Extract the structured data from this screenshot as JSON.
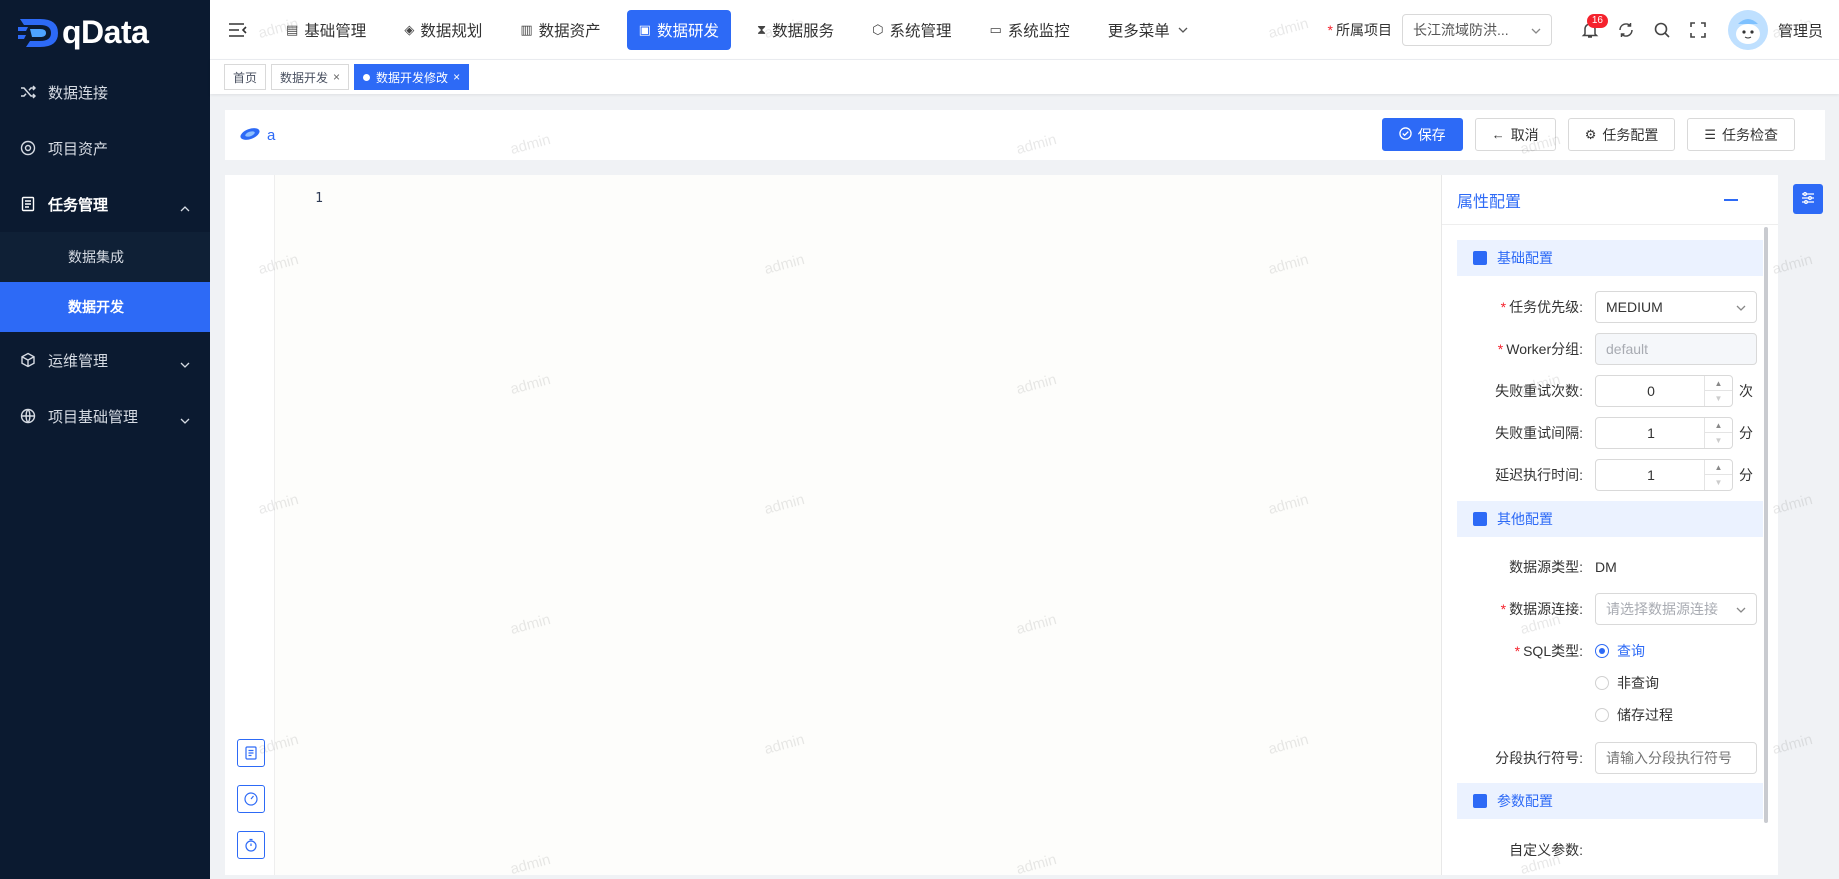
{
  "app": {
    "logo_text": "qData"
  },
  "sidebar": {
    "items": [
      {
        "label": "数据连接"
      },
      {
        "label": "项目资产"
      },
      {
        "label": "任务管理"
      },
      {
        "label": "运维管理"
      },
      {
        "label": "项目基础管理"
      }
    ],
    "task_sub": [
      {
        "label": "数据集成"
      },
      {
        "label": "数据开发"
      }
    ]
  },
  "topnav": {
    "items": [
      {
        "label": "基础管理"
      },
      {
        "label": "数据规划"
      },
      {
        "label": "数据资产"
      },
      {
        "label": "数据研发"
      },
      {
        "label": "数据服务"
      },
      {
        "label": "系统管理"
      },
      {
        "label": "系统监控"
      },
      {
        "label": "更多菜单"
      }
    ],
    "active": "数据研发"
  },
  "header": {
    "project_label": "所属项目",
    "project_value": "长江流域防洪...",
    "notification_count": "16",
    "user_name": "管理员"
  },
  "tabs": [
    {
      "label": "首页"
    },
    {
      "label": "数据开发"
    },
    {
      "label": "数据开发修改"
    }
  ],
  "toolbar": {
    "task_name": "a",
    "save": "保存",
    "cancel": "取消",
    "config": "任务配置",
    "check": "任务检查"
  },
  "editor": {
    "line_number": "1"
  },
  "props": {
    "title": "属性配置",
    "sections": {
      "basic": "基础配置",
      "other": "其他配置",
      "params": "参数配置"
    },
    "priority_label": "任务优先级:",
    "priority_value": "MEDIUM",
    "worker_label": "Worker分组:",
    "worker_value": "default",
    "retry_times_label": "失败重试次数:",
    "retry_times_value": "0",
    "retry_times_unit": "次",
    "retry_interval_label": "失败重试间隔:",
    "retry_interval_value": "1",
    "retry_interval_unit": "分",
    "delay_label": "延迟执行时间:",
    "delay_value": "1",
    "delay_unit": "分",
    "ds_type_label": "数据源类型:",
    "ds_type_value": "DM",
    "ds_conn_label": "数据源连接:",
    "ds_conn_placeholder": "请选择数据源连接",
    "sql_type_label": "SQL类型:",
    "sql_options": [
      "查询",
      "非查询",
      "储存过程"
    ],
    "sql_selected": "查询",
    "segment_label": "分段执行符号:",
    "segment_placeholder": "请输入分段执行符号",
    "custom_params_label": "自定义参数:"
  },
  "watermark": "admin",
  "colors": {
    "accent": "#2d6af6",
    "sidebar_bg": "#0b1a30",
    "danger": "#f5222d"
  }
}
